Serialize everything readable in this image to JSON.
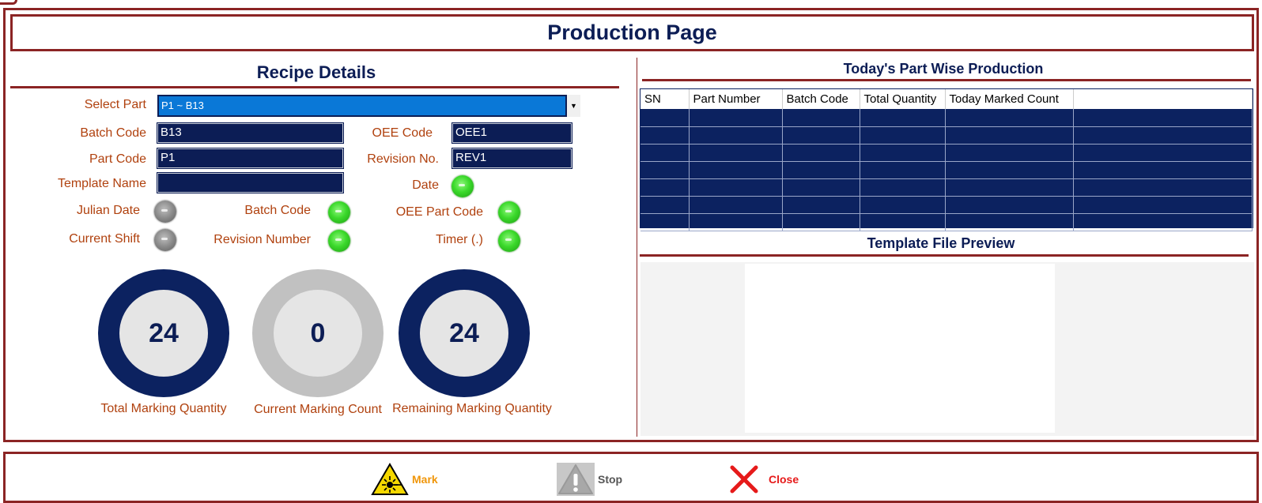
{
  "page": {
    "title": "Production Page"
  },
  "recipe": {
    "title": "Recipe Details",
    "select_part_label": "Select Part",
    "select_part_value": "P1 ~ B13",
    "batch_code_label": "Batch Code",
    "batch_code_value": "B13",
    "oee_code_label": "OEE Code",
    "oee_code_value": "OEE1",
    "part_code_label": "Part Code",
    "part_code_value": "P1",
    "revision_no_label": "Revision No.",
    "revision_no_value": "REV1",
    "template_name_label": "Template Name",
    "template_name_value": "",
    "indicators": {
      "date": {
        "label": "Date",
        "state": "green"
      },
      "julian_date": {
        "label": "Julian Date",
        "state": "gray"
      },
      "batch_code": {
        "label": "Batch Code",
        "state": "green"
      },
      "oee_part_code": {
        "label": "OEE Part Code",
        "state": "green"
      },
      "current_shift": {
        "label": "Current Shift",
        "state": "gray"
      },
      "revision_number": {
        "label": "Revision Number",
        "state": "green"
      },
      "timer": {
        "label": "Timer (.)",
        "state": "green"
      }
    },
    "counters": {
      "total": {
        "value": "24",
        "label": "Total Marking Quantity"
      },
      "current": {
        "value": "0",
        "label": "Current Marking Count"
      },
      "remaining": {
        "value": "24",
        "label": "Remaining Marking Quantity"
      }
    }
  },
  "production": {
    "title": "Today's Part Wise Production",
    "columns": [
      "SN",
      "Part Number",
      "Batch Code",
      "Total Quantity",
      "Today Marked Count",
      ""
    ]
  },
  "preview": {
    "title": "Template File Preview"
  },
  "actions": {
    "mark_label": "Mark",
    "stop_label": "Stop",
    "close_label": "Close"
  },
  "colors": {
    "navy": "#0c1d55",
    "maroon": "#8b2424",
    "label_orange": "#b0410e",
    "select_blue": "#0a78d7",
    "led_green": "#3bd92b"
  }
}
